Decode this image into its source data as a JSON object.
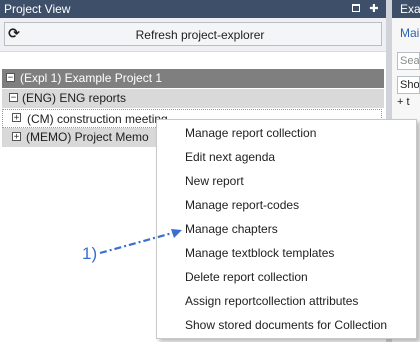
{
  "left_panel": {
    "title": "Project View",
    "refresh_label": "Refresh project-explorer",
    "tree": {
      "project": {
        "toggle": "−",
        "label": "(Expl 1) Example Project 1"
      },
      "eng": {
        "toggle": "−",
        "label": "(ENG) ENG reports"
      },
      "cm": {
        "toggle": "+",
        "label": "(CM) construction meeting"
      },
      "memo": {
        "toggle": "+",
        "label": "(MEMO) Project Memo"
      }
    }
  },
  "right_panel": {
    "title": "Exa",
    "tab": "Mai",
    "search_placeholder": "Search",
    "show_label": "Show",
    "plus_item": "+ t"
  },
  "context_menu": {
    "items": [
      "Manage report collection",
      "Edit next agenda",
      "New report",
      "Manage report-codes",
      "Manage chapters",
      "Manage textblock templates",
      "Delete report collection",
      "Assign reportcollection attributes",
      "Show stored documents for Collection"
    ]
  },
  "annotation": {
    "label": "1)",
    "color": "#3a6fd1"
  },
  "colors": {
    "titlebar": "#3d4f69",
    "selected_row": "#7f7f7f",
    "highlight_row": "#d9d9d9"
  }
}
